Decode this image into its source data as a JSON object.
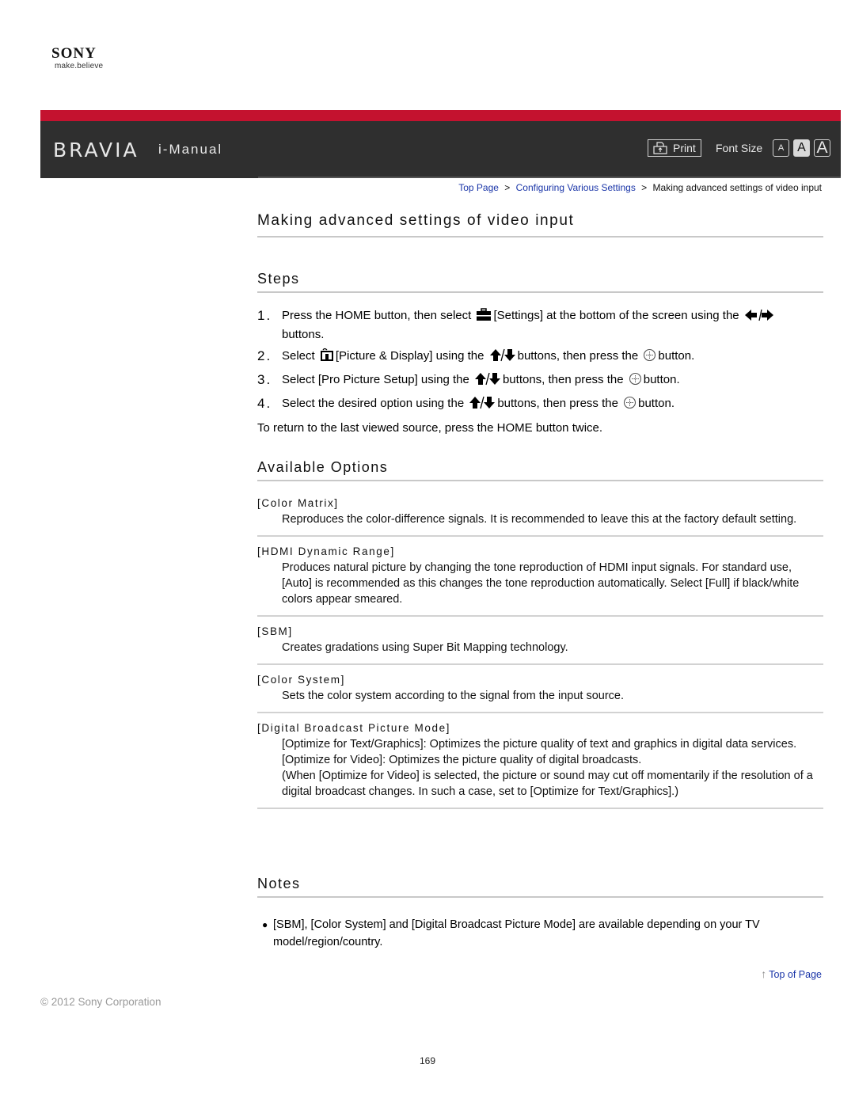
{
  "brand": {
    "logo_text": "SONY",
    "tagline": "make.believe",
    "product": "BRAVIA",
    "app_title": "i-Manual"
  },
  "toolbar": {
    "print_label": "Print",
    "font_size_label": "Font Size",
    "font_size_options": [
      "A",
      "A",
      "A"
    ],
    "font_size_selected": "medium"
  },
  "breadcrumb": {
    "items": [
      {
        "label": "Top Page",
        "link": true
      },
      {
        "label": "Configuring Various Settings",
        "link": true
      },
      {
        "label": "Making advanced settings of video input",
        "link": false
      }
    ],
    "separator": ">"
  },
  "page": {
    "title": "Making advanced settings of video input",
    "steps_heading": "Steps",
    "steps": [
      {
        "num": "1.",
        "parts": [
          "Press the HOME button, then select ",
          "[Settings] at the bottom of the screen using the ",
          "buttons."
        ],
        "icons": [
          "settings-toolbox-icon",
          "left-right-arrows-icon"
        ]
      },
      {
        "num": "2.",
        "parts": [
          "Select ",
          "[Picture & Display] using the ",
          "buttons, then press the ",
          "button."
        ],
        "icons": [
          "picture-display-icon",
          "up-down-arrows-icon",
          "enter-button-icon"
        ]
      },
      {
        "num": "3.",
        "parts": [
          "Select [Pro Picture Setup] using the ",
          "buttons, then press the ",
          "button."
        ],
        "icons": [
          "up-down-arrows-icon",
          "enter-button-icon"
        ]
      },
      {
        "num": "4.",
        "parts": [
          "Select the desired option using the ",
          "buttons, then press the ",
          "button."
        ],
        "icons": [
          "up-down-arrows-icon",
          "enter-button-icon"
        ]
      }
    ],
    "return_text": "To return to the last viewed source, press the HOME button twice.",
    "options_heading": "Available Options",
    "options": [
      {
        "title": "[Color Matrix]",
        "desc": [
          "Reproduces the color-difference signals. It is recommended to leave this at the factory default setting."
        ]
      },
      {
        "title": "[HDMI Dynamic Range]",
        "desc": [
          "Produces natural picture by changing the tone reproduction of HDMI input signals. For standard use, [Auto] is recommended as this changes the tone reproduction automatically. Select [Full] if black/white colors appear smeared."
        ]
      },
      {
        "title": "[SBM]",
        "desc": [
          "Creates gradations using Super Bit Mapping technology."
        ]
      },
      {
        "title": "[Color System]",
        "desc": [
          "Sets the color system according to the signal from the input source."
        ]
      },
      {
        "title": "[Digital Broadcast Picture Mode]",
        "desc": [
          "[Optimize for Text/Graphics]: Optimizes the picture quality of text and graphics in digital data services.",
          "[Optimize for Video]: Optimizes the picture quality of digital broadcasts.",
          "(When [Optimize for Video] is selected, the picture or sound may cut off momentarily if the resolution of a digital broadcast changes. In such a case, set to [Optimize for Text/Graphics].)"
        ]
      }
    ],
    "notes_heading": "Notes",
    "notes": [
      "[SBM], [Color System] and [Digital Broadcast Picture Mode] are available depending on your TV model/region/country."
    ]
  },
  "footer": {
    "top_of_page": "Top of Page",
    "copyright": "© 2012 Sony Corporation",
    "page_number": "169"
  },
  "colors": {
    "accent_red": "#c4122f",
    "header_dark": "#2f2f2f",
    "link_blue": "#1a35a8",
    "rule_gray": "#c8c8c8"
  }
}
